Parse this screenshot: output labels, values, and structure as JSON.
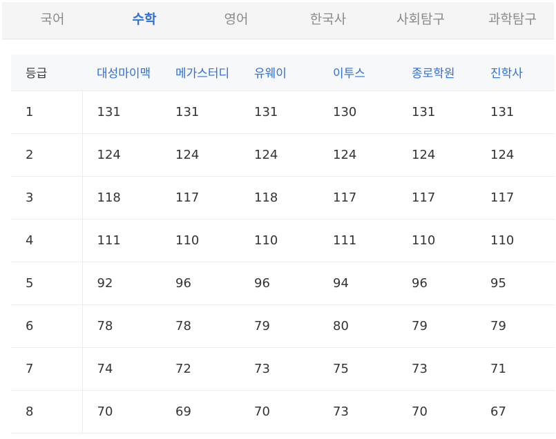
{
  "tabs": [
    {
      "label": "국어",
      "active": false
    },
    {
      "label": "수학",
      "active": true
    },
    {
      "label": "영어",
      "active": false
    },
    {
      "label": "한국사",
      "active": false
    },
    {
      "label": "사회탐구",
      "active": false
    },
    {
      "label": "과학탐구",
      "active": false
    }
  ],
  "table": {
    "grade_header": "등급",
    "providers": [
      "대성마이맥",
      "메가스터디",
      "유웨이",
      "이투스",
      "종로학원",
      "진학사"
    ],
    "rows": [
      {
        "grade": "1",
        "values": [
          "131",
          "131",
          "131",
          "130",
          "131",
          "131"
        ]
      },
      {
        "grade": "2",
        "values": [
          "124",
          "124",
          "124",
          "124",
          "124",
          "124"
        ]
      },
      {
        "grade": "3",
        "values": [
          "118",
          "117",
          "118",
          "117",
          "117",
          "117"
        ]
      },
      {
        "grade": "4",
        "values": [
          "111",
          "110",
          "110",
          "111",
          "110",
          "110"
        ]
      },
      {
        "grade": "5",
        "values": [
          "92",
          "96",
          "96",
          "94",
          "96",
          "95"
        ]
      },
      {
        "grade": "6",
        "values": [
          "78",
          "78",
          "79",
          "80",
          "79",
          "79"
        ]
      },
      {
        "grade": "7",
        "values": [
          "74",
          "72",
          "73",
          "75",
          "73",
          "71"
        ]
      },
      {
        "grade": "8",
        "values": [
          "70",
          "69",
          "70",
          "73",
          "70",
          "67"
        ]
      }
    ]
  },
  "colors": {
    "accent": "#2f6fd6",
    "tab_inactive": "#8a8a8a",
    "text": "#333333"
  }
}
